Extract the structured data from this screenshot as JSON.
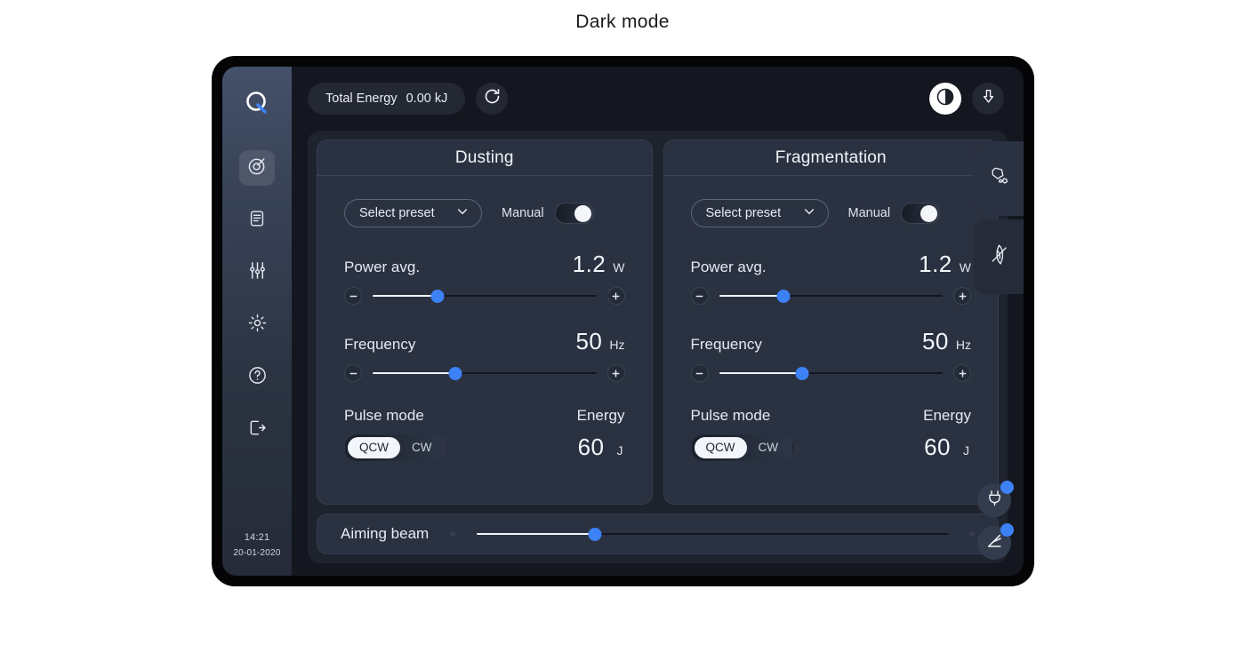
{
  "caption": "Dark mode",
  "theme": {
    "accent": "#3c82f6",
    "panel_bg": "#2a3140",
    "screen_bg": "#14171f",
    "sidebar_top": "#44516a",
    "text": "#e8ecf3"
  },
  "sidebar": {
    "logo": "q-logo-icon",
    "items": [
      {
        "name": "sidebar-item-target",
        "icon": "target-icon",
        "active": true
      },
      {
        "name": "sidebar-item-document",
        "icon": "document-icon",
        "active": false
      },
      {
        "name": "sidebar-item-sliders",
        "icon": "sliders-icon",
        "active": false
      },
      {
        "name": "sidebar-item-settings",
        "icon": "gear-icon",
        "active": false
      },
      {
        "name": "sidebar-item-help",
        "icon": "question-circle-icon",
        "active": false
      },
      {
        "name": "sidebar-item-logout",
        "icon": "logout-icon",
        "active": false
      }
    ],
    "time": "14:21",
    "date": "20-01-2020"
  },
  "topbar": {
    "total_energy_label": "Total Energy",
    "total_energy_value": "0.00 kJ",
    "refresh_icon": "refresh-icon",
    "contrast_icon": "contrast-icon",
    "download_icon": "download-arrow-icon"
  },
  "panels": [
    {
      "title": "Dusting",
      "preset_label": "Select preset",
      "manual_label": "Manual",
      "manual_on": true,
      "power": {
        "label": "Power avg.",
        "value": "1.2",
        "unit": "W",
        "slider_percent": 29
      },
      "frequency": {
        "label": "Frequency",
        "value": "50",
        "unit": "Hz",
        "slider_percent": 37
      },
      "pulse": {
        "label": "Pulse mode",
        "options": [
          "QCW",
          "CW"
        ],
        "selected": "QCW"
      },
      "energy": {
        "label": "Energy",
        "value": "60",
        "unit": "J"
      }
    },
    {
      "title": "Fragmentation",
      "preset_label": "Select preset",
      "manual_label": "Manual",
      "manual_on": true,
      "power": {
        "label": "Power avg.",
        "value": "1.2",
        "unit": "W",
        "slider_percent": 29
      },
      "frequency": {
        "label": "Frequency",
        "value": "50",
        "unit": "Hz",
        "slider_percent": 37
      },
      "pulse": {
        "label": "Pulse mode",
        "options": [
          "QCW",
          "CW"
        ],
        "selected": "QCW"
      },
      "energy": {
        "label": "Energy",
        "value": "60",
        "unit": "J"
      }
    }
  ],
  "aiming_beam": {
    "label": "Aiming beam",
    "slider_percent": 25
  },
  "right_rail": [
    {
      "name": "rail-tab-stone",
      "icon": "stone-icon"
    },
    {
      "name": "rail-tab-fiber",
      "icon": "fiber-icon"
    }
  ],
  "floating_buttons": [
    {
      "name": "fab-plug",
      "icon": "plug-icon",
      "badge": true
    },
    {
      "name": "fab-laser-fiber",
      "icon": "laser-fiber-icon",
      "badge": true
    }
  ]
}
